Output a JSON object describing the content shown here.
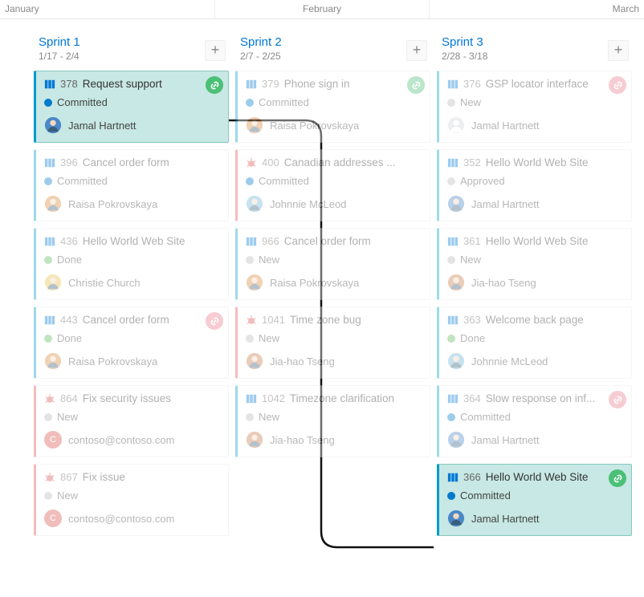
{
  "timeline": {
    "m1": "January",
    "m2": "February",
    "m3": "March"
  },
  "columns": [
    {
      "title": "Sprint 1",
      "dates": "1/17 - 2/4"
    },
    {
      "title": "Sprint 2",
      "dates": "2/7 - 2/25"
    },
    {
      "title": "Sprint 3",
      "dates": "2/28 - 3/18"
    }
  ],
  "ui": {
    "add": "+"
  },
  "states": {
    "Committed": "#007acc",
    "Done": "#5cb85c",
    "New": "#bbbbbb",
    "Approved": "#bbbbbb"
  },
  "avatars": {
    "Jamal Hartnett": {
      "type": "img",
      "bg": "#4a88c7"
    },
    "Raisa Pokrovskaya": {
      "type": "img",
      "bg": "#d98a3d"
    },
    "Christie Church": {
      "type": "img",
      "bg": "#e8c04a"
    },
    "Johnnie McLeod": {
      "type": "img",
      "bg": "#6fb5d6"
    },
    "Jia-hao Tseng": {
      "type": "img",
      "bg": "#c77a4a"
    },
    "contoso@contoso.com": {
      "type": "initial",
      "bg": "#d9534f",
      "text": "C"
    },
    "unassigned": {
      "type": "silhouette",
      "bg": "#cfd3d6"
    }
  },
  "cards": [
    [
      {
        "icon": "pbi",
        "id": "378",
        "title": "Request support",
        "state": "Committed",
        "person": "Jamal Hartnett",
        "badge": "green",
        "highlight": true
      },
      {
        "icon": "pbi",
        "id": "396",
        "title": "Cancel order form",
        "state": "Committed",
        "person": "Raisa Pokrovskaya"
      },
      {
        "icon": "pbi",
        "id": "436",
        "title": "Hello World Web Site",
        "state": "Done",
        "person": "Christie Church"
      },
      {
        "icon": "pbi",
        "id": "443",
        "title": "Cancel order form",
        "state": "Done",
        "person": "Raisa Pokrovskaya",
        "badge": "red"
      },
      {
        "icon": "bug",
        "id": "864",
        "title": "Fix security issues",
        "state": "New",
        "person": "contoso@contoso.com"
      },
      {
        "icon": "bug",
        "id": "867",
        "title": "Fix issue",
        "state": "New",
        "person": "contoso@contoso.com"
      }
    ],
    [
      {
        "icon": "pbi",
        "id": "379",
        "title": "Phone sign in",
        "state": "Committed",
        "person": "Raisa Pokrovskaya",
        "badge": "green"
      },
      {
        "icon": "bug",
        "id": "400",
        "title": "Canadian addresses ...",
        "state": "Committed",
        "person": "Johnnie McLeod"
      },
      {
        "icon": "pbi",
        "id": "966",
        "title": "Cancel order form",
        "state": "New",
        "person": "Raisa Pokrovskaya"
      },
      {
        "icon": "bug",
        "id": "1041",
        "title": "Time zone bug",
        "state": "New",
        "person": "Jia-hao Tseng"
      },
      {
        "icon": "pbi",
        "id": "1042",
        "title": "Timezone clarification",
        "state": "New",
        "person": "Jia-hao Tseng"
      }
    ],
    [
      {
        "icon": "pbi",
        "id": "376",
        "title": "GSP locator interface",
        "state": "New",
        "person": "unassigned",
        "personLabel": "Jamal Hartnett",
        "badge": "red"
      },
      {
        "icon": "pbi",
        "id": "352",
        "title": "Hello World Web Site",
        "state": "Approved",
        "person": "Jamal Hartnett"
      },
      {
        "icon": "pbi",
        "id": "361",
        "title": "Hello World Web Site",
        "state": "New",
        "person": "Jia-hao Tseng"
      },
      {
        "icon": "pbi",
        "id": "363",
        "title": "Welcome back page",
        "state": "Done",
        "person": "Johnnie McLeod"
      },
      {
        "icon": "pbi",
        "id": "364",
        "title": "Slow response on inf...",
        "state": "Committed",
        "person": "Jamal Hartnett",
        "badge": "red"
      },
      {
        "icon": "pbi",
        "id": "366",
        "title": "Hello World Web Site",
        "state": "Committed",
        "person": "Jamal Hartnett",
        "badge": "green",
        "highlight": true
      }
    ]
  ]
}
